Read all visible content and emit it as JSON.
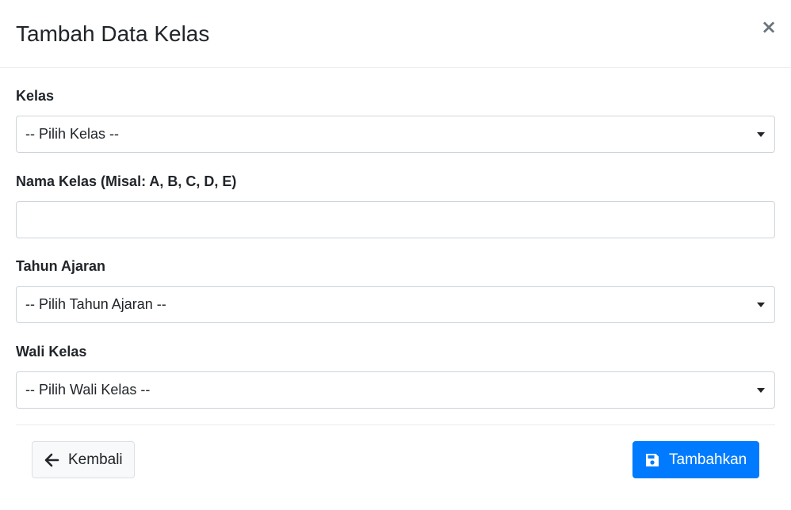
{
  "modal": {
    "title": "Tambah Data Kelas",
    "close_glyph": "×",
    "close_icon": "close-icon"
  },
  "form": {
    "kelas": {
      "label": "Kelas",
      "selected": "-- Pilih Kelas --"
    },
    "nama_kelas": {
      "label": "Nama Kelas (Misal: A, B, C, D, E)",
      "value": "",
      "placeholder": ""
    },
    "tahun_ajaran": {
      "label": "Tahun Ajaran",
      "selected": "-- Pilih Tahun Ajaran --"
    },
    "wali_kelas": {
      "label": "Wali Kelas",
      "selected": "-- Pilih Wali Kelas --"
    }
  },
  "footer": {
    "back_label": "Kembali",
    "back_icon": "arrow-left-icon",
    "submit_label": "Tambahkan",
    "submit_icon": "save-icon"
  },
  "colors": {
    "primary": "#007bff",
    "secondary_bg": "#f8f9fa",
    "border": "#ced4da",
    "divider": "#e9ecef",
    "text": "#212529",
    "muted": "#6c757d"
  }
}
